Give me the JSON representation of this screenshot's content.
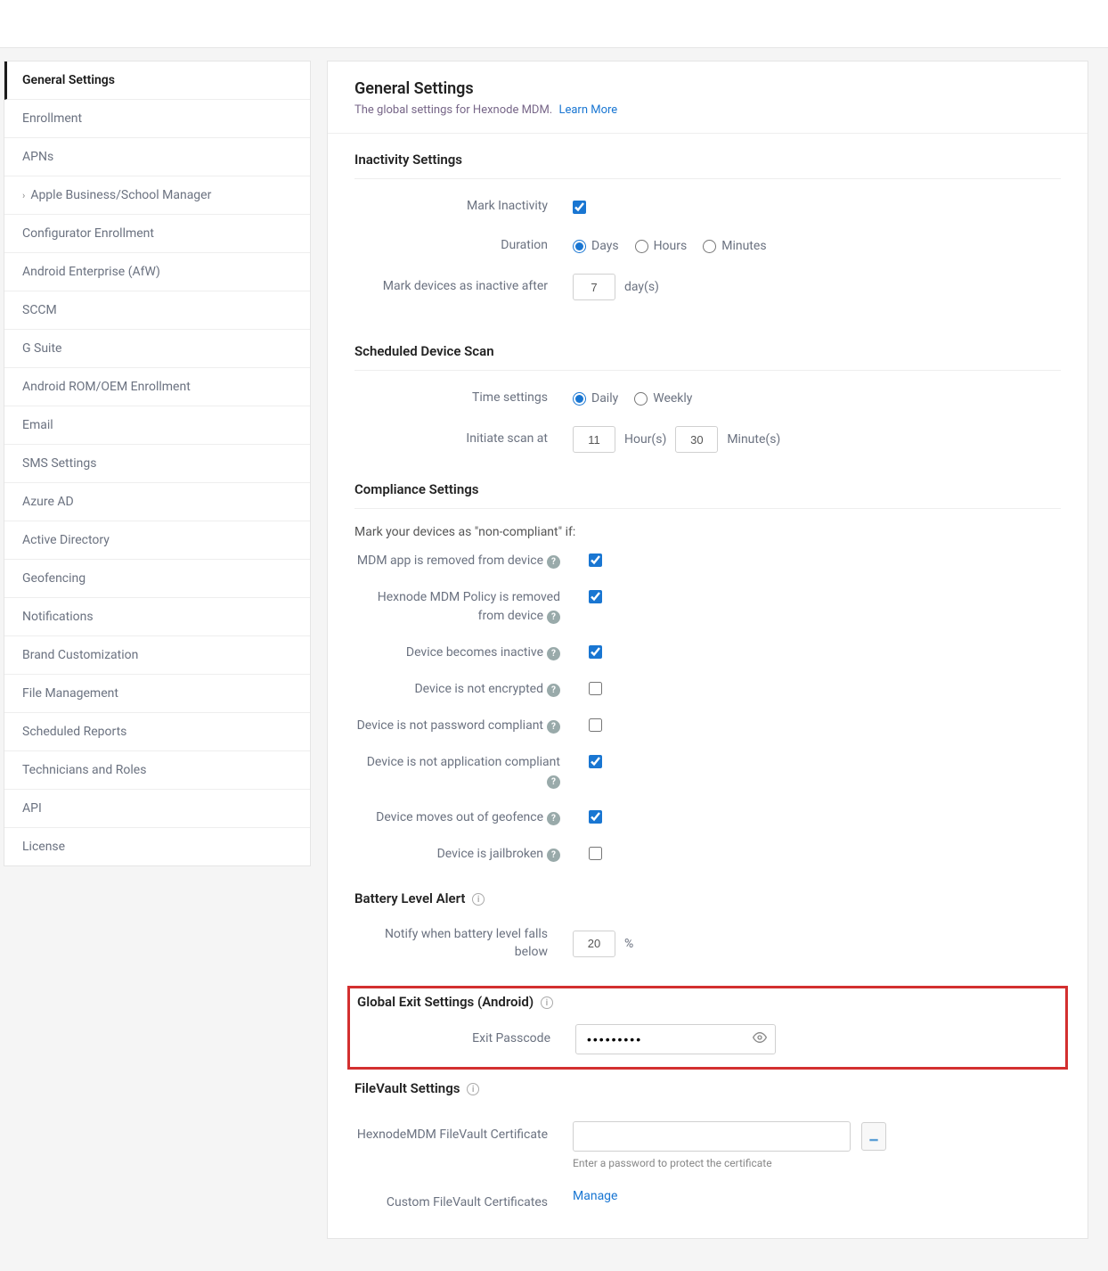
{
  "sidebar": {
    "items": [
      {
        "label": "General Settings",
        "active": true
      },
      {
        "label": "Enrollment"
      },
      {
        "label": "APNs"
      },
      {
        "label": "Apple Business/School Manager",
        "chevron": true
      },
      {
        "label": "Configurator Enrollment"
      },
      {
        "label": "Android Enterprise (AfW)"
      },
      {
        "label": "SCCM"
      },
      {
        "label": "G Suite"
      },
      {
        "label": "Android ROM/OEM Enrollment"
      },
      {
        "label": "Email"
      },
      {
        "label": "SMS Settings"
      },
      {
        "label": "Azure AD"
      },
      {
        "label": "Active Directory"
      },
      {
        "label": "Geofencing"
      },
      {
        "label": "Notifications"
      },
      {
        "label": "Brand Customization"
      },
      {
        "label": "File Management"
      },
      {
        "label": "Scheduled Reports"
      },
      {
        "label": "Technicians and Roles"
      },
      {
        "label": "API"
      },
      {
        "label": "License"
      }
    ]
  },
  "header": {
    "title": "General Settings",
    "subtitle": "The global settings for Hexnode MDM.",
    "learn_more": "Learn More"
  },
  "inactivity": {
    "title": "Inactivity Settings",
    "mark_inactivity_label": "Mark Inactivity",
    "mark_inactivity_checked": true,
    "duration_label": "Duration",
    "duration_options": {
      "days": "Days",
      "hours": "Hours",
      "minutes": "Minutes"
    },
    "duration_selected": "days",
    "mark_after_label": "Mark devices as inactive after",
    "mark_after_value": "7",
    "mark_after_unit": "day(s)"
  },
  "scan": {
    "title": "Scheduled Device Scan",
    "time_settings_label": "Time settings",
    "time_options": {
      "daily": "Daily",
      "weekly": "Weekly"
    },
    "time_selected": "daily",
    "initiate_label": "Initiate scan at",
    "hour_value": "11",
    "hour_unit": "Hour(s)",
    "minute_value": "30",
    "minute_unit": "Minute(s)"
  },
  "compliance": {
    "title": "Compliance Settings",
    "intro": "Mark your devices as \"non-compliant\" if:",
    "items": [
      {
        "label": "MDM app is removed from device",
        "help": true,
        "checked": true
      },
      {
        "label": "Hexnode MDM Policy is removed from device",
        "help": true,
        "checked": true
      },
      {
        "label": "Device becomes inactive",
        "help": true,
        "checked": true
      },
      {
        "label": "Device is not encrypted",
        "help": true,
        "checked": false
      },
      {
        "label": "Device is not password compliant",
        "help": true,
        "checked": false
      },
      {
        "label": "Device is not application compliant",
        "help": true,
        "checked": true
      },
      {
        "label": "Device moves out of geofence",
        "help": true,
        "checked": true
      },
      {
        "label": "Device is jailbroken",
        "help": true,
        "checked": false
      }
    ]
  },
  "battery": {
    "title": "Battery Level Alert",
    "notify_label": "Notify when battery level falls below",
    "value": "20",
    "unit": "%"
  },
  "exit": {
    "title": "Global Exit Settings (Android)",
    "passcode_label": "Exit Passcode",
    "passcode_value": "•••••••••"
  },
  "filevault": {
    "title": "FileVault Settings",
    "cert_label": "HexnodeMDM FileVault Certificate",
    "cert_help": "Enter a password to protect the certificate",
    "custom_label": "Custom FileVault Certificates",
    "manage": "Manage"
  }
}
